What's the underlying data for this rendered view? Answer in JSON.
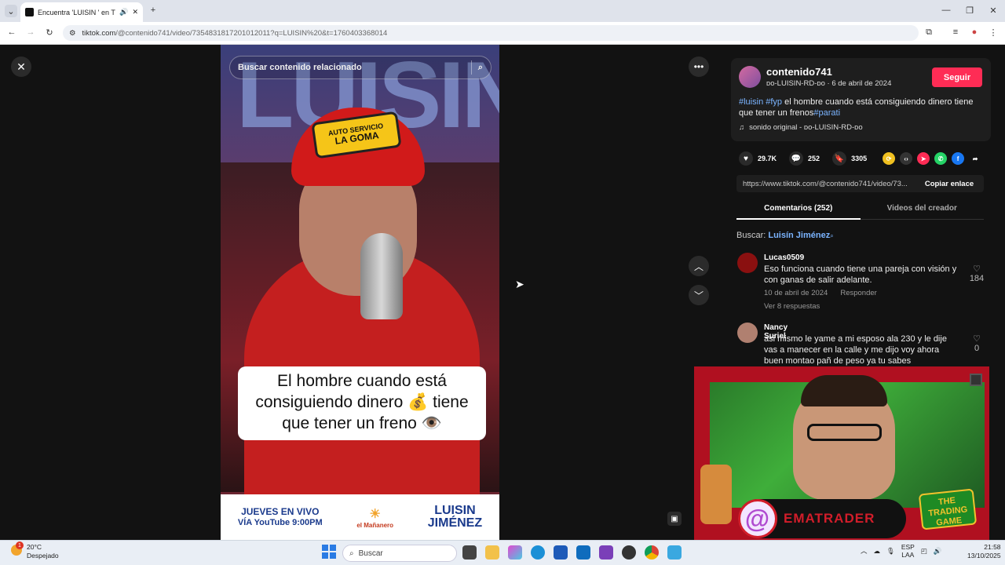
{
  "browser": {
    "tab_title": "Encuentra 'LUISIN ' en TikTo",
    "url_host": "tiktok.com",
    "url_path": "/@contenido741/video/7354831817201012011?q=LUISIN%20&t=1760403368014"
  },
  "video": {
    "search_placeholder": "Buscar contenido relacionado",
    "caption_line1": "El hombre cuando está",
    "caption_line2": "consiguiendo dinero 💰 tiene",
    "caption_line3": "que tener un freno 👁️",
    "cap_line1": "AUTO SERVICIO",
    "cap_line2": "LA GOMA",
    "bg_text": "LUISIN",
    "banner_left_1": "JUEVES EN VIVO",
    "banner_left_2": "VÍA YouTube 9:00PM",
    "banner_mid": "el Mañanero",
    "banner_right_1": "LUISIN",
    "banner_right_2": "JIMÉNEZ"
  },
  "post": {
    "username": "contenido741",
    "subline": "ᴅᴏ-LUISIN-RD-ᴅᴏ · 6 de abril de 2024",
    "follow_label": "Seguir",
    "desc_tag1": "#luisin",
    "desc_tag2": "#fyp",
    "desc_text": " el hombre cuando está consiguiendo dinero tiene que tener un frenos",
    "desc_tag3": "#parati",
    "sound": "sonido original - ᴅᴏ-LUISIN-RD-ᴅᴏ",
    "likes": "29.7K",
    "comments": "252",
    "saves": "3305",
    "link": "https://www.tiktok.com/@contenido741/video/73...",
    "copy_label": "Copiar enlace"
  },
  "tabs": {
    "comments": "Comentarios (252)",
    "creator_videos": "Videos del creador"
  },
  "search_keyword": {
    "prefix": "Buscar:",
    "keyword": "Luisín Jiménez"
  },
  "comments": [
    {
      "user": "Lucas0509",
      "text": "Eso funciona cuando tiene una pareja con visión y con ganas de salir adelante.",
      "date": "10 de abril de 2024",
      "reply": "Responder",
      "replies": "Ver 8 respuestas",
      "likes": "184"
    },
    {
      "user": "Nancy Suriel",
      "text": "asi mismo le yame a mi esposo ala 230 y le dije vas a manecer en la calle y me dijo voy ahora buen montao pañ de peso ya tu sabes",
      "likes": "0"
    }
  ],
  "overlay": {
    "streamer_name": "EMATRADER",
    "game_badge": "THE TRADING GAME"
  },
  "taskbar": {
    "temperature": "20°C",
    "weather": "Despejado",
    "search": "Buscar",
    "lang1": "ESP",
    "lang2": "LAA",
    "time": "21:58",
    "date": "13/10/2025",
    "notification_badge": "1"
  }
}
